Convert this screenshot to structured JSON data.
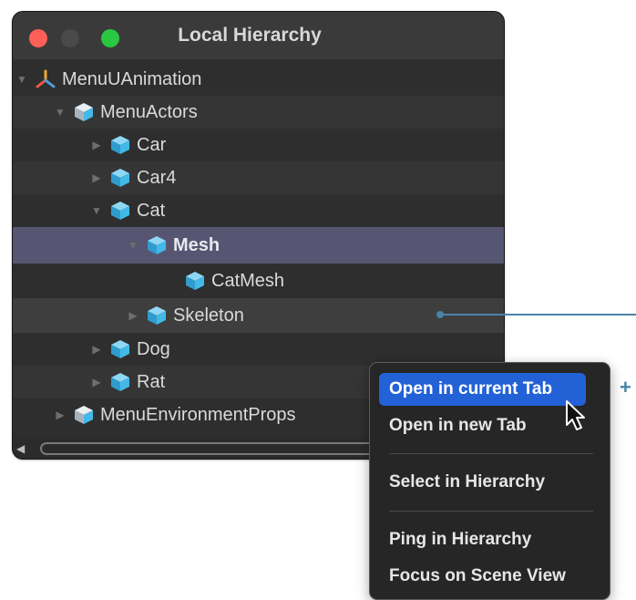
{
  "window": {
    "title": "Local Hierarchy",
    "colors": {
      "close": "#fe5f57",
      "maximize": "#28c840",
      "selection": "#565673",
      "cube": "#43b9e8",
      "menu_highlight": "#2361d6",
      "connector": "#4a82a8"
    }
  },
  "tree": {
    "rows": [
      {
        "label": "MenuUAnimation",
        "expanded": true,
        "icon": "animation-axes-icon"
      },
      {
        "label": "MenuActors",
        "expanded": true,
        "icon": "prefab-cube-icon"
      },
      {
        "label": "Car",
        "expanded": false,
        "icon": "cube-icon"
      },
      {
        "label": "Car4",
        "expanded": false,
        "icon": "cube-icon"
      },
      {
        "label": "Cat",
        "expanded": true,
        "icon": "cube-icon"
      },
      {
        "label": "Mesh",
        "expanded": true,
        "icon": "cube-icon",
        "selected": true
      },
      {
        "label": "CatMesh",
        "icon": "cube-icon"
      },
      {
        "label": "Skeleton",
        "expanded": false,
        "icon": "cube-icon"
      },
      {
        "label": "Dog",
        "expanded": false,
        "icon": "cube-icon"
      },
      {
        "label": "Rat",
        "expanded": false,
        "icon": "cube-icon"
      },
      {
        "label": "MenuEnvironmentProps",
        "expanded": false,
        "icon": "prefab-cube-icon"
      }
    ]
  },
  "context_menu": {
    "items": [
      {
        "label": "Open in current Tab",
        "highlighted": true
      },
      {
        "label": "Open in new Tab"
      },
      {
        "label": "Select in Hierarchy"
      },
      {
        "label": "Ping in Hierarchy"
      },
      {
        "label": "Focus on Scene View"
      }
    ]
  },
  "annotation": {
    "plus_symbol": "+"
  }
}
